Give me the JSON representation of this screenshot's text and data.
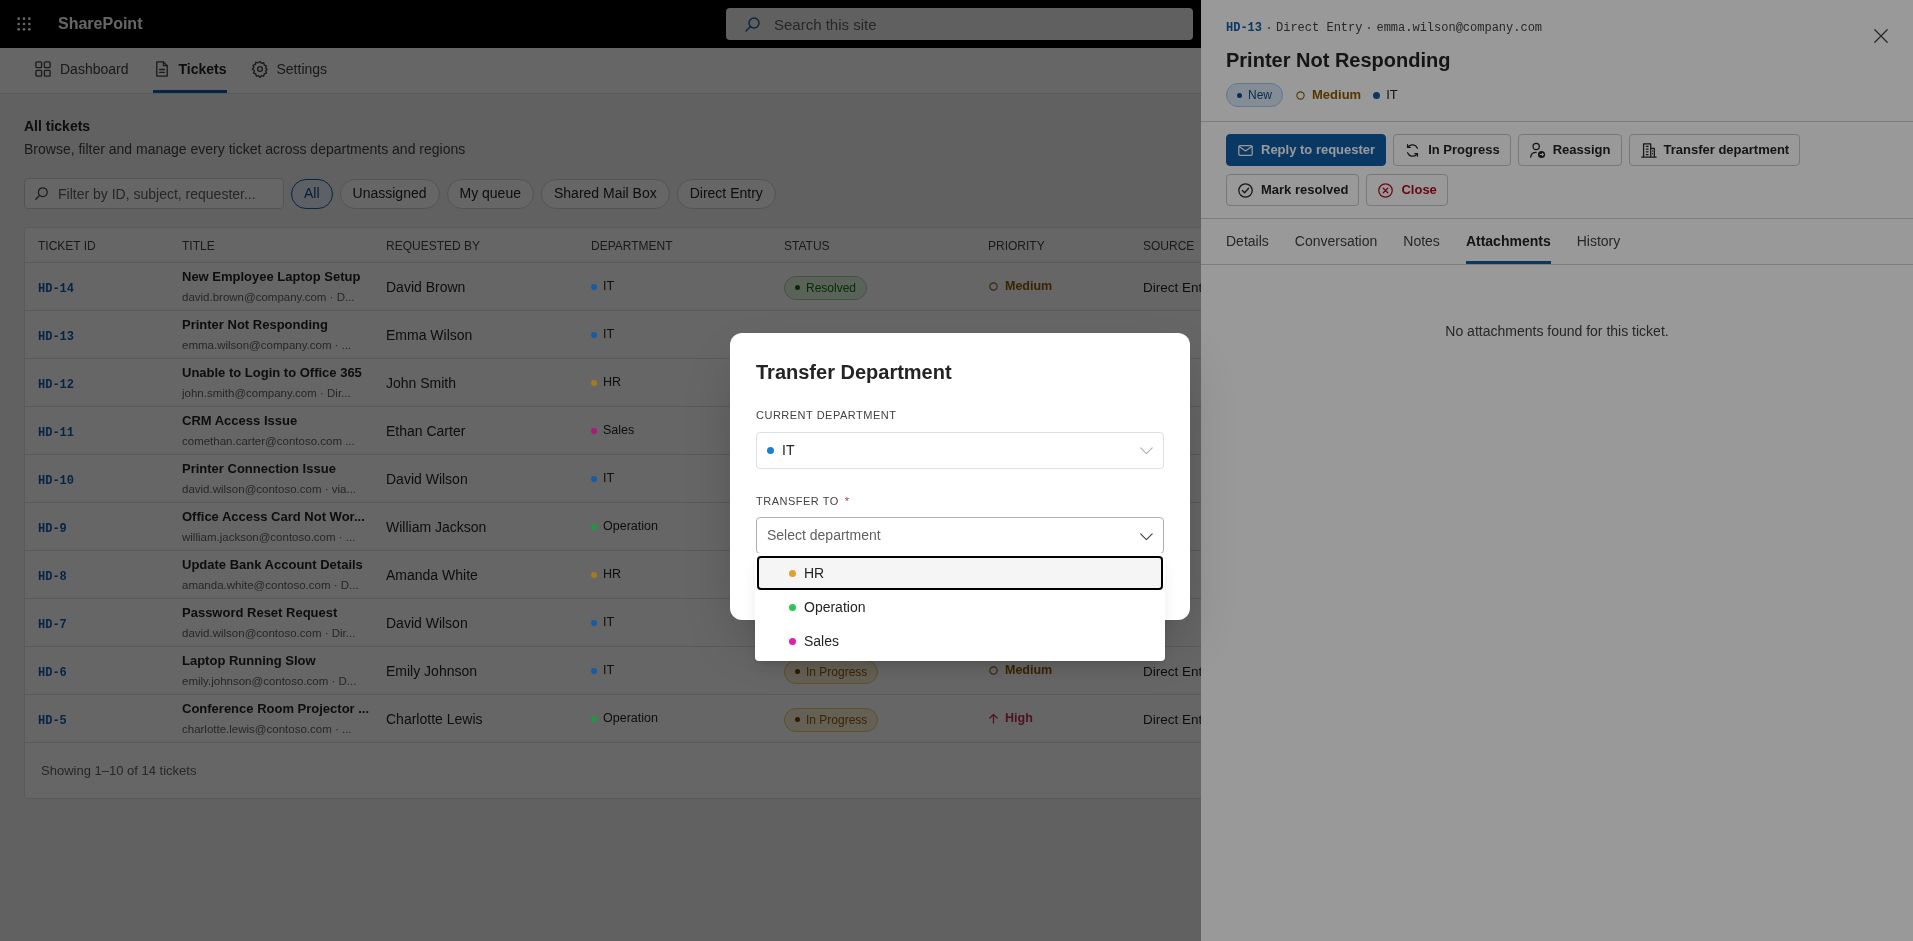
{
  "app": {
    "name": "SharePoint",
    "search_placeholder": "Search this site"
  },
  "nav": [
    {
      "label": "Dashboard",
      "selected": false
    },
    {
      "label": "Tickets",
      "selected": true
    },
    {
      "label": "Settings",
      "selected": false
    }
  ],
  "heading": {
    "title": "All tickets",
    "subtitle": "Browse, filter and manage every ticket across departments and regions"
  },
  "filter": {
    "placeholder": "Filter by ID, subject, requester..."
  },
  "chips": [
    {
      "label": "All",
      "selected": true
    },
    {
      "label": "Unassigned",
      "selected": false
    },
    {
      "label": "My queue",
      "selected": false
    },
    {
      "label": "Shared Mail Box",
      "selected": false
    },
    {
      "label": "Direct Entry",
      "selected": false
    }
  ],
  "table": {
    "columns": [
      "TICKET ID",
      "TITLE",
      "REQUESTED BY",
      "DEPARTMENT",
      "STATUS",
      "PRIORITY",
      "SOURCE"
    ],
    "rows": [
      {
        "id": "HD-14",
        "title": "New Employee Laptop Setup",
        "subtitle": "david.brown@company.com · D...",
        "requester": "David Brown",
        "department": {
          "name": "IT",
          "color": "#0f5ea8"
        },
        "status": {
          "label": "Resolved",
          "kind": "resolved"
        },
        "priority": {
          "label": "Medium",
          "kind": "medium"
        },
        "source": "Direct Ent"
      },
      {
        "id": "HD-13",
        "title": "Printer Not Responding",
        "subtitle": "emma.wilson@company.com · ...",
        "requester": "Emma Wilson",
        "department": {
          "name": "IT",
          "color": "#0f5ea8"
        }
      },
      {
        "id": "HD-12",
        "title": "Unable to Login to Office 365",
        "subtitle": "john.smith@company.com · Dir...",
        "requester": "John Smith",
        "department": {
          "name": "HR",
          "color": "#a87a1c"
        }
      },
      {
        "id": "HD-11",
        "title": "CRM Access Issue",
        "subtitle": "comethan.carter@contoso.com ...",
        "requester": "Ethan Carter",
        "department": {
          "name": "Sales",
          "color": "#b0157f"
        }
      },
      {
        "id": "HD-10",
        "title": "Printer Connection Issue",
        "subtitle": "david.wilson@contoso.com · via...",
        "requester": "David Wilson",
        "department": {
          "name": "IT",
          "color": "#0f5ea8"
        }
      },
      {
        "id": "HD-9",
        "title": "Office Access Card Not Wor...",
        "subtitle": "william.jackson@contoso.com · ...",
        "requester": "William Jackson",
        "department": {
          "name": "Operation",
          "color": "#1e9a3c"
        }
      },
      {
        "id": "HD-8",
        "title": "Update Bank Account Details",
        "subtitle": "amanda.white@contoso.com · D...",
        "requester": "Amanda White",
        "department": {
          "name": "HR",
          "color": "#a87a1c"
        }
      },
      {
        "id": "HD-7",
        "title": "Password Reset Request",
        "subtitle": "david.wilson@contoso.com · Dir...",
        "requester": "David Wilson",
        "department": {
          "name": "IT",
          "color": "#0f5ea8"
        }
      },
      {
        "id": "HD-6",
        "title": "Laptop Running Slow",
        "subtitle": "emily.johnson@contoso.com · D...",
        "requester": "Emily Johnson",
        "department": {
          "name": "IT",
          "color": "#0f5ea8"
        },
        "status": {
          "label": "In Progress",
          "kind": "progress"
        },
        "priority": {
          "label": "Medium",
          "kind": "medium"
        },
        "source": "Direct Ent"
      },
      {
        "id": "HD-5",
        "title": "Conference Room Projector ...",
        "subtitle": "charlotte.lewis@contoso.com · ...",
        "requester": "Charlotte Lewis",
        "department": {
          "name": "Operation",
          "color": "#1e9a3c"
        },
        "status": {
          "label": "In Progress",
          "kind": "progress"
        },
        "priority": {
          "label": "High",
          "kind": "high"
        },
        "source": "Direct Ent"
      }
    ],
    "footer": "Showing 1–10 of 14 tickets"
  },
  "panel": {
    "ticket_id": "HD-13",
    "meta": [
      "Direct Entry",
      "emma.wilson@company.com"
    ],
    "title": "Printer Not Responding",
    "status": {
      "label": "New",
      "kind": "new"
    },
    "priority": {
      "label": "Medium",
      "kind": "medium"
    },
    "department": {
      "name": "IT",
      "color": "#093865"
    },
    "actions": [
      {
        "label": "Reply to requester",
        "kind": "primary"
      },
      {
        "label": "In Progress",
        "kind": "default"
      },
      {
        "label": "Reassign",
        "kind": "default"
      },
      {
        "label": "Transfer department",
        "kind": "default"
      },
      {
        "label": "Mark resolved",
        "kind": "default"
      },
      {
        "label": "Close",
        "kind": "danger"
      }
    ],
    "tabs": [
      {
        "label": "Details",
        "selected": false
      },
      {
        "label": "Conversation",
        "selected": false
      },
      {
        "label": "Notes",
        "selected": false
      },
      {
        "label": "Attachments",
        "selected": true
      },
      {
        "label": "History",
        "selected": false
      }
    ],
    "empty_message": "No attachments found for this ticket."
  },
  "dialog": {
    "title": "Transfer Department",
    "current_label": "CURRENT DEPARTMENT",
    "current": {
      "name": "IT",
      "color": "#1a7fd6"
    },
    "target_label": "TRANSFER TO",
    "required_mark": "*",
    "target_placeholder": "Select department",
    "options": [
      {
        "name": "HR",
        "color": "#e0a030",
        "selected": true
      },
      {
        "name": "Operation",
        "color": "#2dc653",
        "selected": false
      },
      {
        "name": "Sales",
        "color": "#e020b0",
        "selected": false
      }
    ]
  }
}
